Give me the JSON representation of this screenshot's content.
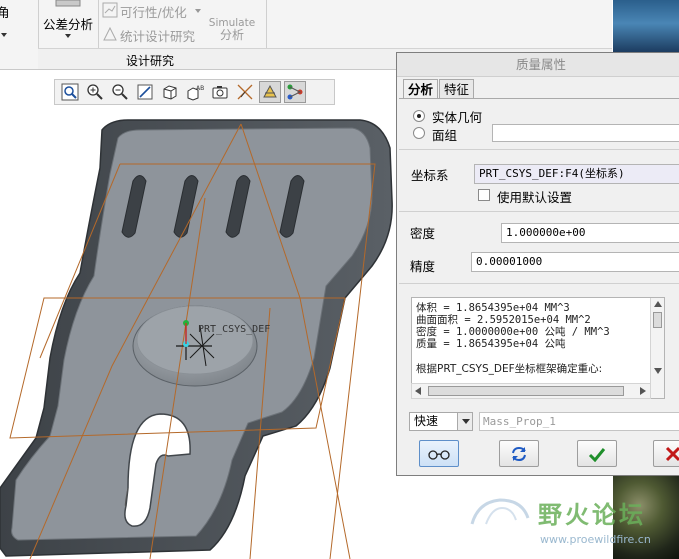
{
  "ribbon": {
    "left_partial_label": "角",
    "tolerance_analysis": "公差分析",
    "feasibility_optimize": "可行性/优化",
    "statistical_design_study": "统计设计研究",
    "simulate_line1": "Simulate",
    "simulate_line2": "分析",
    "group_design_study": "设计研究"
  },
  "view_toolbar": {
    "buttons": [
      "zoom-window",
      "zoom-in",
      "zoom-out",
      "refit",
      "display-style",
      "named-view",
      "saved-orientations",
      "datum-display",
      "spin-center",
      "appearance"
    ]
  },
  "model": {
    "csys_label": "PRT_CSYS_DEF"
  },
  "dialog": {
    "title": "质量属性",
    "tabs": [
      "分析",
      "特征"
    ],
    "radio_solid": "实体几何",
    "radio_quilt": "面组",
    "csys_label": "坐标系",
    "csys_value": "PRT_CSYS_DEF:F4(坐标系)",
    "use_default": "使用默认设置",
    "density_label": "密度",
    "density_value": "1.000000e+00",
    "precision_label": "精度",
    "precision_value": "0.00001000",
    "results": [
      "体积 =  1.8654395e+04  MM^3",
      "曲面面积 =  2.5952015e+04  MM^2",
      "密度 =  1.0000000e+00 公吨 / MM^3",
      "质量 =  1.8654395e+04 公吨",
      "",
      "根据PRT_CSYS_DEF坐标框架确定重心:"
    ],
    "mode_value": "快速",
    "name_value": "Mass_Prop_1"
  },
  "colors": {
    "model_gray": "#8e949b",
    "datum_orange": "#b4692a",
    "ok_green": "#1f8f2b",
    "cancel_red": "#c21818",
    "watermark_green": "#6ab05a"
  },
  "watermark": {
    "text": "野火论坛",
    "url": "www.proewildfire.cn"
  }
}
